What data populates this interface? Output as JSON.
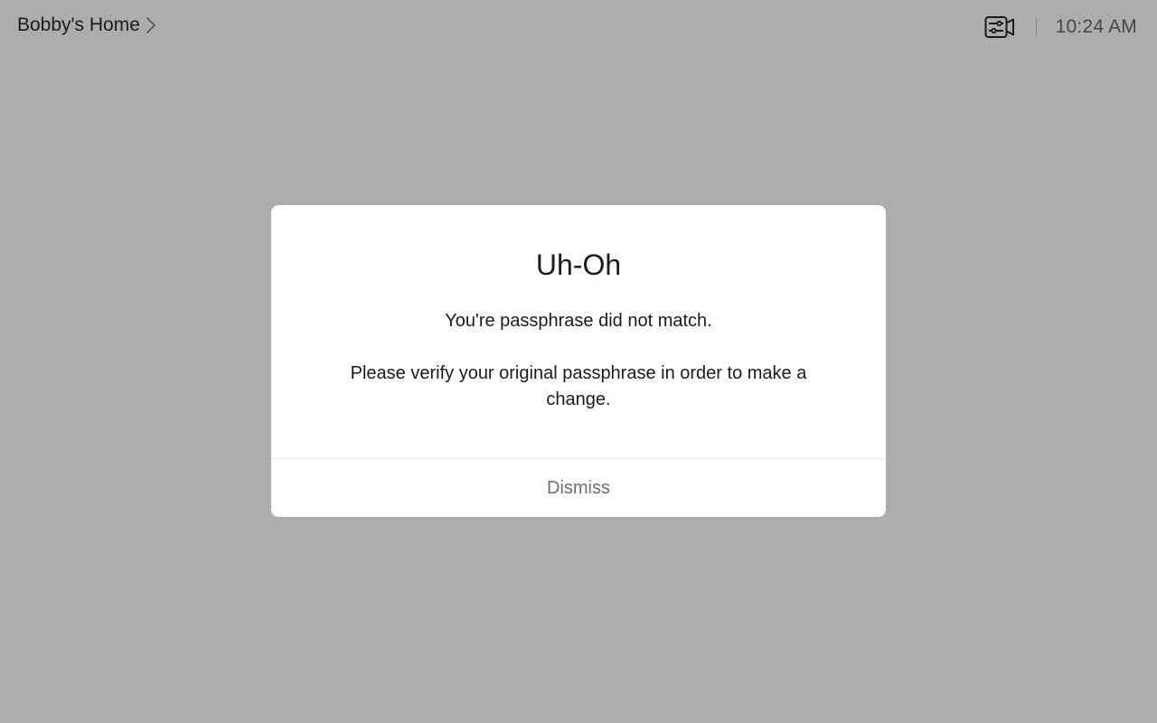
{
  "header": {
    "location": "Bobby's Home",
    "time": "10:24 AM",
    "camera_icon": "camera-settings-icon",
    "chevron_icon": "chevron-right-icon"
  },
  "dialog": {
    "title": "Uh-Oh",
    "message_line1": "You're passphrase did not match.",
    "message_line2": "Please verify your original passphrase in order to make a change.",
    "dismiss_label": "Dismiss"
  },
  "colors": {
    "backdrop": "#adadad",
    "dialog_bg": "#ffffff",
    "text": "#1b1b1b",
    "muted_text": "#6e6e6e"
  }
}
